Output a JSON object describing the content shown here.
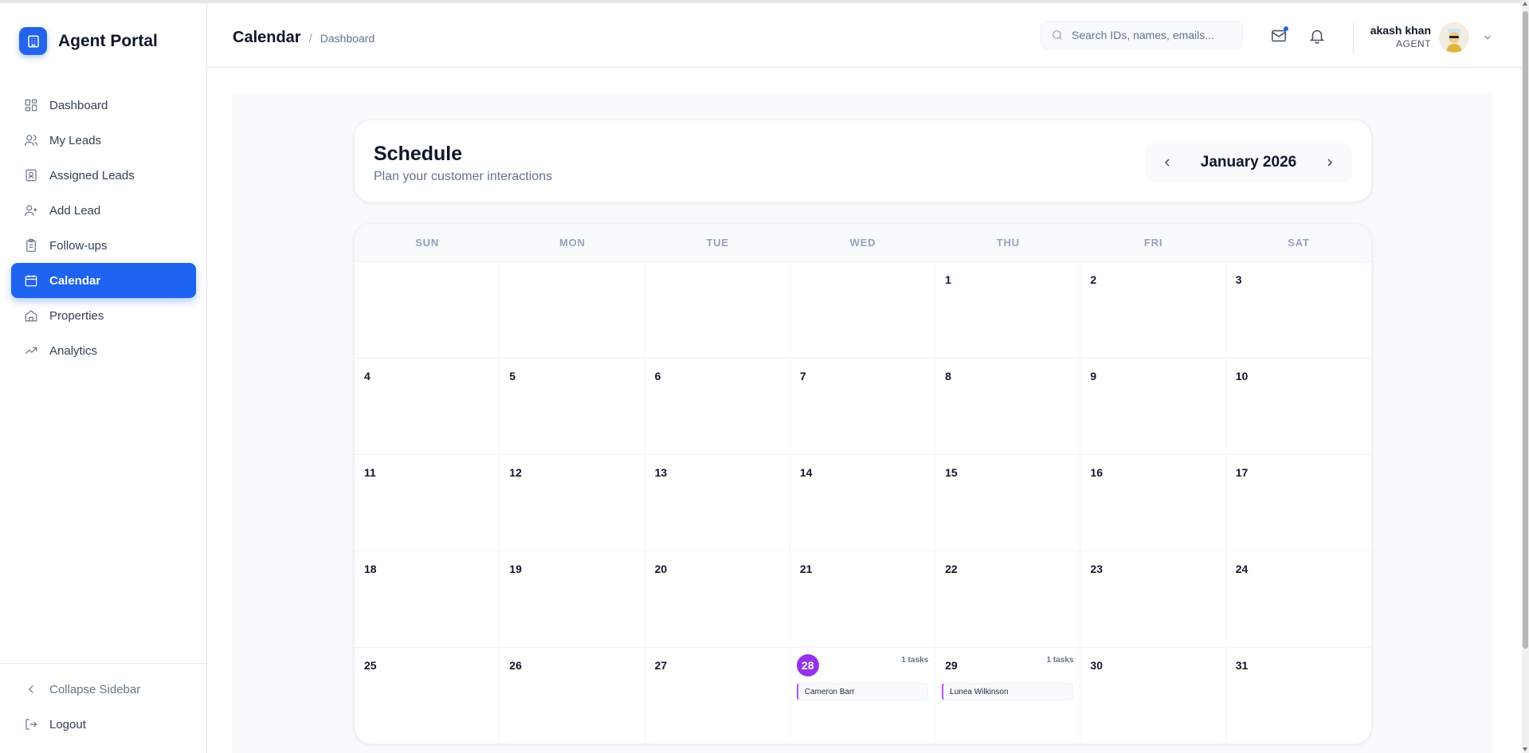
{
  "app": {
    "title": "Agent Portal",
    "accent": "#1d63f0"
  },
  "sidebar": {
    "items": [
      {
        "label": "Dashboard",
        "icon": "dashboard-icon"
      },
      {
        "label": "My Leads",
        "icon": "users-icon"
      },
      {
        "label": "Assigned Leads",
        "icon": "contact-card-icon"
      },
      {
        "label": "Add Lead",
        "icon": "user-plus-icon"
      },
      {
        "label": "Follow-ups",
        "icon": "clipboard-icon"
      },
      {
        "label": "Calendar",
        "icon": "calendar-icon",
        "active": true
      },
      {
        "label": "Properties",
        "icon": "home-icon"
      },
      {
        "label": "Analytics",
        "icon": "trending-up-icon"
      }
    ],
    "collapse_label": "Collapse Sidebar",
    "logout_label": "Logout"
  },
  "header": {
    "title": "Calendar",
    "breadcrumb": "Dashboard",
    "search_placeholder": "Search IDs, names, emails...",
    "user": {
      "name": "akash khan",
      "role": "AGENT"
    }
  },
  "schedule": {
    "title": "Schedule",
    "subtitle": "Plan your customer interactions",
    "month": "January 2026"
  },
  "calendar": {
    "weekdays": [
      "SUN",
      "MON",
      "TUE",
      "WED",
      "THU",
      "FRI",
      "SAT"
    ],
    "days": [
      "",
      "",
      "",
      "",
      "1",
      "2",
      "3",
      "4",
      "5",
      "6",
      "7",
      "8",
      "9",
      "10",
      "11",
      "12",
      "13",
      "14",
      "15",
      "16",
      "17",
      "18",
      "19",
      "20",
      "21",
      "22",
      "23",
      "24",
      "25",
      "26",
      "27",
      "28",
      "29",
      "30",
      "31"
    ],
    "today": "28",
    "today_color": "#9333ea",
    "events": {
      "28": {
        "count_label": "1 tasks",
        "name": "Cameron Barr"
      },
      "29": {
        "count_label": "1 tasks",
        "name": "Lunea Wilkinson"
      }
    }
  }
}
